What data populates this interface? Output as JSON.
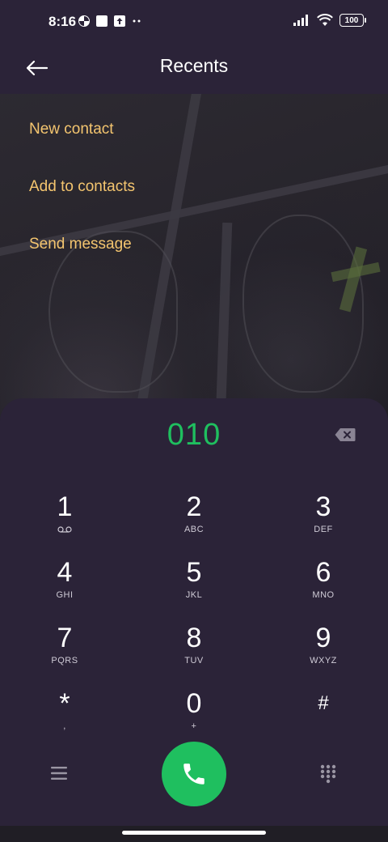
{
  "status_bar": {
    "time": "8:16",
    "battery": "100",
    "left_icons": [
      "pinwheel-icon",
      "square-icon",
      "upload-icon",
      "more-dots-icon"
    ],
    "right_icons": [
      "signal-icon",
      "wifi-icon",
      "battery-icon"
    ]
  },
  "header": {
    "title": "Recents",
    "back_icon": "back-arrow-icon"
  },
  "menu": {
    "items": [
      {
        "label": "New contact"
      },
      {
        "label": "Add to contacts"
      },
      {
        "label": "Send message"
      }
    ]
  },
  "dialpad": {
    "number": "010",
    "keys": [
      {
        "digit": "1",
        "letters": ""
      },
      {
        "digit": "2",
        "letters": "ABC"
      },
      {
        "digit": "3",
        "letters": "DEF"
      },
      {
        "digit": "4",
        "letters": "GHI"
      },
      {
        "digit": "5",
        "letters": "JKL"
      },
      {
        "digit": "6",
        "letters": "MNO"
      },
      {
        "digit": "7",
        "letters": "PQRS"
      },
      {
        "digit": "8",
        "letters": "TUV"
      },
      {
        "digit": "9",
        "letters": "WXYZ"
      },
      {
        "digit": "*",
        "letters": ","
      },
      {
        "digit": "0",
        "letters": "+"
      },
      {
        "digit": "#",
        "letters": ""
      }
    ]
  },
  "colors": {
    "accent_green": "#1fbf5f",
    "menu_text": "#f4c56f",
    "panel_bg": "#2b2338"
  }
}
